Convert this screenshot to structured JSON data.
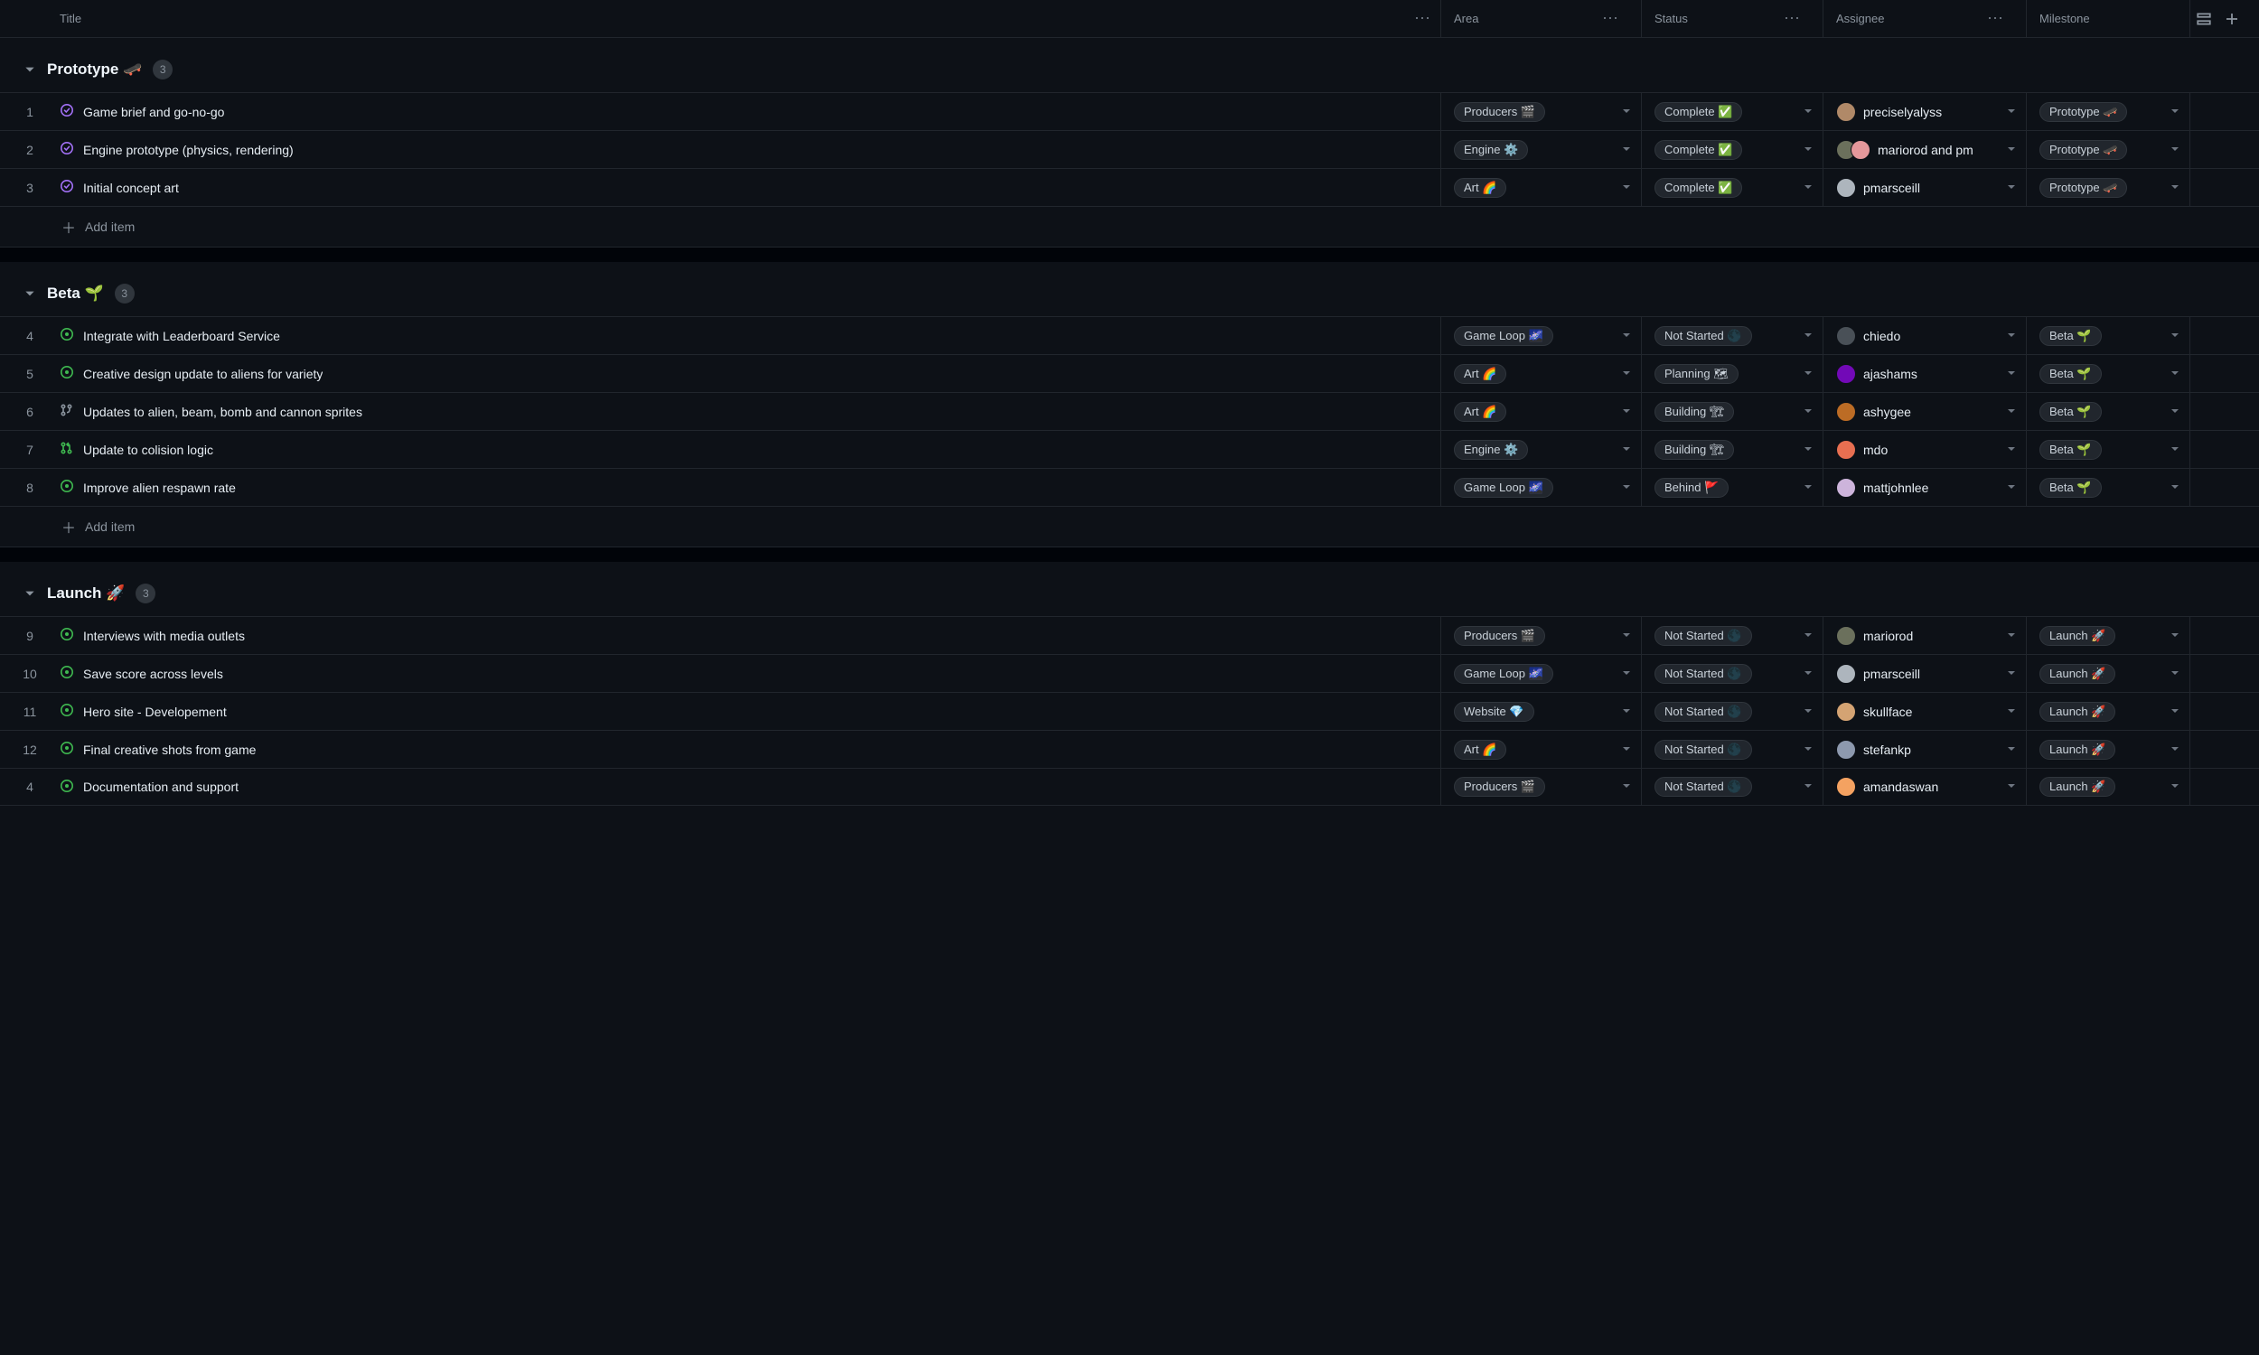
{
  "columns": {
    "title": "Title",
    "area": "Area",
    "status": "Status",
    "assignee": "Assignee",
    "milestone": "Milestone"
  },
  "add_item_label": "Add item",
  "groups": [
    {
      "name": "Prototype 🛹",
      "count": "3",
      "rows": [
        {
          "num": "1",
          "icon": "closed",
          "title": "Game brief and go-no-go",
          "area": "Producers 🎬",
          "status": "Complete ✅",
          "assignees": [
            "preciselyalyss"
          ],
          "avatar_colors": [
            "#b08968"
          ],
          "milestone": "Prototype 🛹"
        },
        {
          "num": "2",
          "icon": "closed",
          "title": "Engine prototype (physics, rendering)",
          "area": "Engine ⚙️",
          "status": "Complete ✅",
          "assignees": [
            "mariorod and pm"
          ],
          "avatar_colors": [
            "#6b705c",
            "#e5989b"
          ],
          "milestone": "Prototype 🛹"
        },
        {
          "num": "3",
          "icon": "closed",
          "title": "Initial concept art",
          "area": "Art 🌈",
          "status": "Complete ✅",
          "assignees": [
            "pmarsceill"
          ],
          "avatar_colors": [
            "#adb5bd"
          ],
          "milestone": "Prototype 🛹"
        }
      ]
    },
    {
      "name": "Beta 🌱",
      "count": "3",
      "rows": [
        {
          "num": "4",
          "icon": "open",
          "title": "Integrate with Leaderboard Service",
          "area": "Game Loop 🌌",
          "status": "Not Started 🌑",
          "assignees": [
            "chiedo"
          ],
          "avatar_colors": [
            "#495057"
          ],
          "milestone": "Beta 🌱"
        },
        {
          "num": "5",
          "icon": "open",
          "title": "Creative design update to aliens for variety",
          "area": "Art 🌈",
          "status": "Planning 🗺",
          "assignees": [
            "ajashams"
          ],
          "avatar_colors": [
            "#7209b7"
          ],
          "milestone": "Beta 🌱"
        },
        {
          "num": "6",
          "icon": "draft",
          "title": "Updates to alien, beam, bomb and cannon sprites",
          "area": "Art 🌈",
          "status": "Building 🏗",
          "assignees": [
            "ashygee"
          ],
          "avatar_colors": [
            "#bc6c25"
          ],
          "milestone": "Beta 🌱"
        },
        {
          "num": "7",
          "icon": "pr",
          "title": "Update to colision logic",
          "area": "Engine ⚙️",
          "status": "Building 🏗",
          "assignees": [
            "mdo"
          ],
          "avatar_colors": [
            "#e76f51"
          ],
          "milestone": "Beta 🌱"
        },
        {
          "num": "8",
          "icon": "open",
          "title": "Improve alien respawn rate",
          "area": "Game Loop 🌌",
          "status": "Behind 🚩",
          "assignees": [
            "mattjohnlee"
          ],
          "avatar_colors": [
            "#cdb4db"
          ],
          "milestone": "Beta 🌱"
        }
      ]
    },
    {
      "name": "Launch 🚀",
      "count": "3",
      "rows": [
        {
          "num": "9",
          "icon": "open",
          "title": "Interviews with media outlets",
          "area": "Producers 🎬",
          "status": "Not Started 🌑",
          "assignees": [
            "mariorod"
          ],
          "avatar_colors": [
            "#6b705c"
          ],
          "milestone": "Launch 🚀"
        },
        {
          "num": "10",
          "icon": "open",
          "title": "Save score across levels",
          "area": "Game Loop 🌌",
          "status": "Not Started 🌑",
          "assignees": [
            "pmarsceill"
          ],
          "avatar_colors": [
            "#adb5bd"
          ],
          "milestone": "Launch 🚀"
        },
        {
          "num": "11",
          "icon": "open",
          "title": "Hero site - Developement",
          "area": "Website 💎",
          "status": "Not Started 🌑",
          "assignees": [
            "skullface"
          ],
          "avatar_colors": [
            "#d4a373"
          ],
          "milestone": "Launch 🚀"
        },
        {
          "num": "12",
          "icon": "open",
          "title": "Final creative shots from game",
          "area": "Art 🌈",
          "status": "Not Started 🌑",
          "assignees": [
            "stefankp"
          ],
          "avatar_colors": [
            "#8d99ae"
          ],
          "milestone": "Launch 🚀"
        },
        {
          "num": "4",
          "icon": "open",
          "title": "Documentation and support",
          "area": "Producers 🎬",
          "status": "Not Started 🌑",
          "assignees": [
            "amandaswan"
          ],
          "avatar_colors": [
            "#f4a261"
          ],
          "milestone": "Launch 🚀"
        }
      ]
    }
  ]
}
